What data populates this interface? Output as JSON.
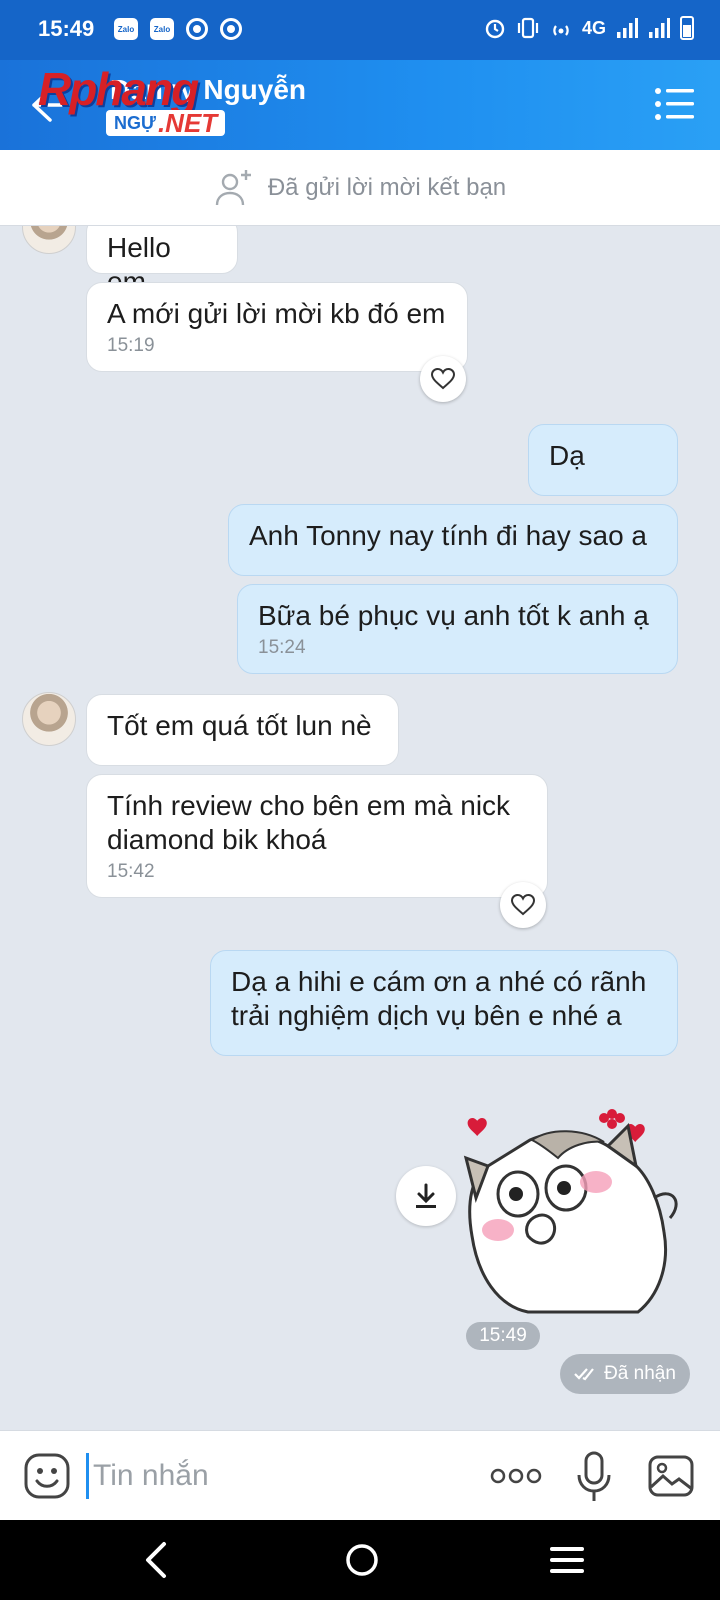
{
  "status_bar": {
    "time": "15:49",
    "apps": [
      "Zalo",
      "Zalo"
    ],
    "network": "4G"
  },
  "header": {
    "contact_name": "Danny Nguyễn",
    "watermark_main": "Rphang",
    "watermark_sub": "NGỰ",
    "watermark_net": ".NET"
  },
  "friend_request": {
    "text": "Đã gửi lời mời kết bạn"
  },
  "messages": [
    {
      "side": "in",
      "text": "Hello em"
    },
    {
      "side": "in",
      "text": "A mới gửi lời mời kb đó em",
      "time": "15:19"
    },
    {
      "side": "out",
      "text": "Dạ"
    },
    {
      "side": "out",
      "text": "Anh Tonny nay tính đi hay sao a"
    },
    {
      "side": "out",
      "text": "Bữa bé phục vụ anh tốt k anh ạ",
      "time": "15:24"
    },
    {
      "side": "in",
      "text": "Tốt em quá tốt lun nè"
    },
    {
      "side": "in",
      "text": "Tính review cho bên em mà nick diamond bik khoá",
      "time": "15:42"
    },
    {
      "side": "out",
      "text": "Dạ a hihi e cám ơn a nhé có rãnh trải nghiệm dịch vụ bên e nhé a"
    }
  ],
  "sticker": {
    "time": "15:49",
    "status": "Đã nhận"
  },
  "composer": {
    "placeholder": "Tin nhắn"
  },
  "icons": {
    "back": "arrow-left-icon",
    "menu": "list-icon",
    "add_friend": "user-plus-icon",
    "like": "heart-icon",
    "download": "download-icon",
    "emoji": "smile-icon",
    "more": "dots-icon",
    "mic": "microphone-icon",
    "image": "image-icon"
  }
}
